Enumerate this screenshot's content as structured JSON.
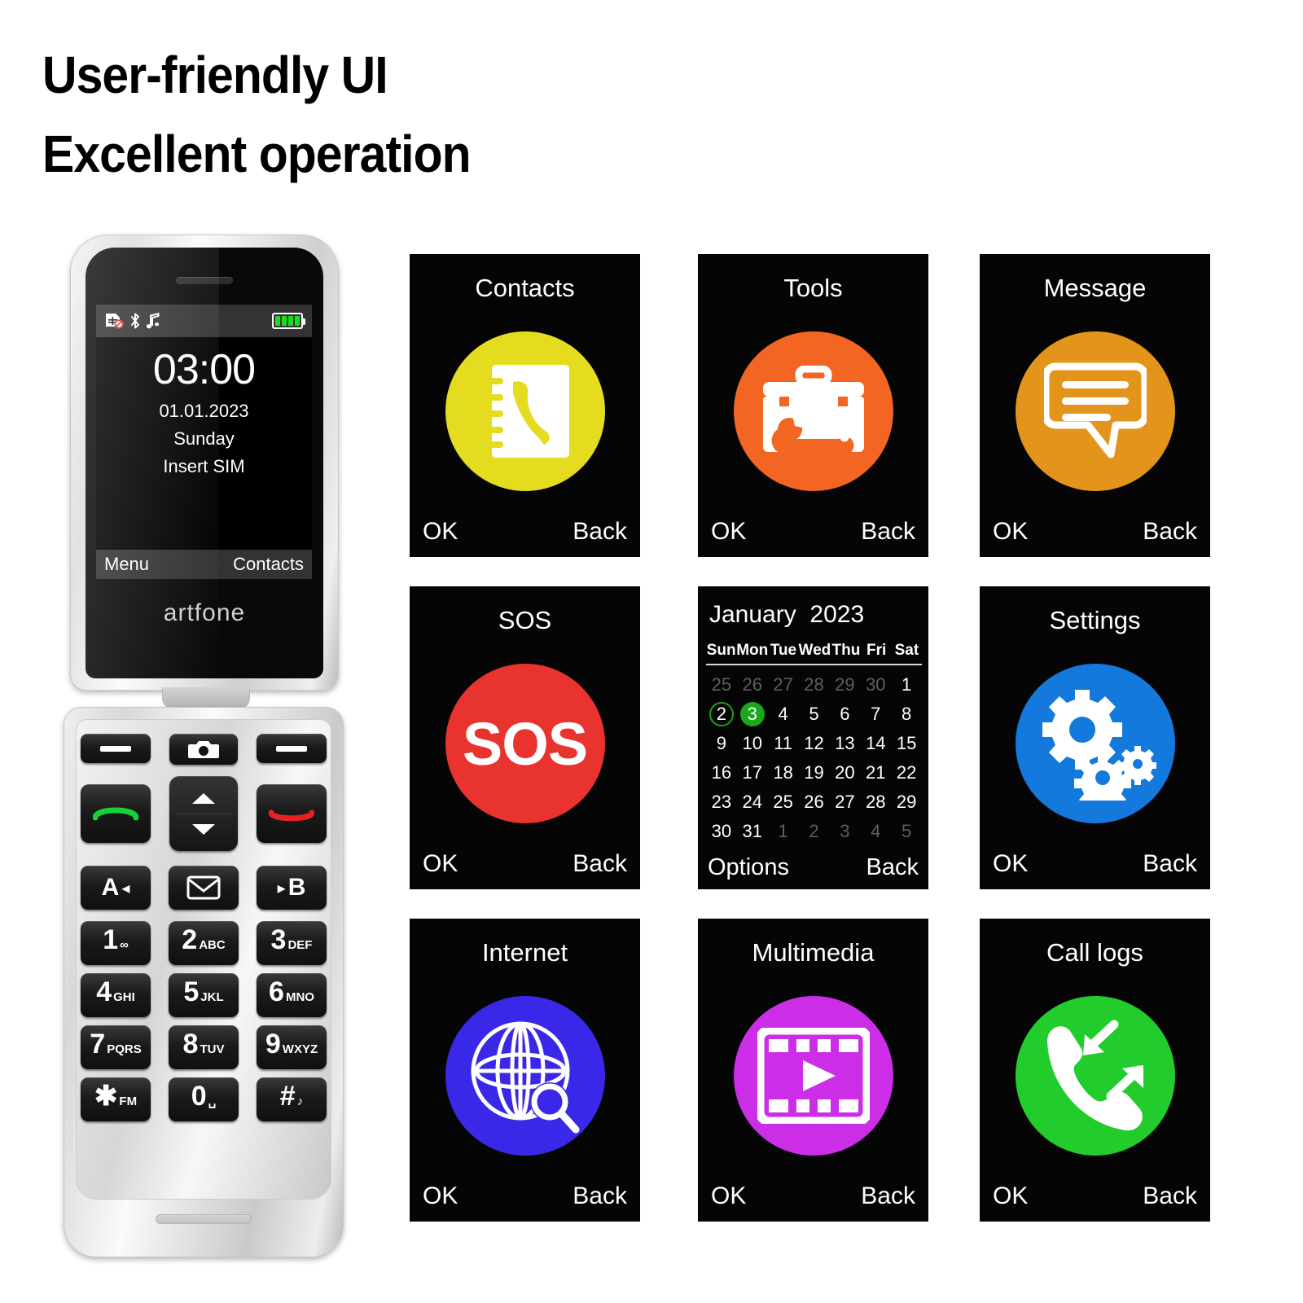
{
  "headline": {
    "line1": "User-friendly UI",
    "line2": "Excellent operation"
  },
  "phone": {
    "brand": "artfone",
    "screen": {
      "status_icons": [
        "sim-blocked-icon",
        "bluetooth-icon",
        "music-note-icon",
        "battery-full-icon"
      ],
      "time": "03:00",
      "date": "01.01.2023",
      "weekday": "Sunday",
      "sim_status": "Insert SIM",
      "softkey_left": "Menu",
      "softkey_right": "Contacts"
    },
    "keys": {
      "row_soft": [
        "soft-left-key",
        "camera-key",
        "soft-right-key"
      ],
      "row_call": [
        "call-answer-key",
        "nav-updown-key",
        "call-end-key"
      ],
      "row_fn": [
        {
          "label": "A",
          "arrow": "◂"
        },
        {
          "label": "envelope-icon",
          "arrow": ""
        },
        {
          "label": "B",
          "arrow": "▸"
        }
      ],
      "numbers": [
        {
          "main": "1",
          "sub": "∞"
        },
        {
          "main": "2",
          "sub": "ABC"
        },
        {
          "main": "3",
          "sub": "DEF"
        },
        {
          "main": "4",
          "sub": "GHI"
        },
        {
          "main": "5",
          "sub": "JKL"
        },
        {
          "main": "6",
          "sub": "MNO"
        },
        {
          "main": "7",
          "sub": "PQRS"
        },
        {
          "main": "8",
          "sub": "TUV"
        },
        {
          "main": "9",
          "sub": "WXYZ"
        },
        {
          "main": "✱",
          "sub": "FM"
        },
        {
          "main": "0",
          "sub": "␣"
        },
        {
          "main": "#",
          "sub": "♪"
        }
      ]
    }
  },
  "tiles": {
    "softkey_ok": "OK",
    "softkey_back": "Back",
    "items": [
      {
        "title": "Contacts",
        "icon": "address-book-icon",
        "color": "#E5DC1F"
      },
      {
        "title": "Tools",
        "icon": "toolbox-icon",
        "color": "#F26522"
      },
      {
        "title": "Message",
        "icon": "chat-bubble-icon",
        "color": "#E2951A"
      },
      {
        "title": "SOS",
        "icon": "sos-icon",
        "color": "#E8332F",
        "icon_text": "SOS"
      },
      {
        "title": "Settings",
        "icon": "gears-icon",
        "color": "#1479DC"
      },
      {
        "title": "Internet",
        "icon": "globe-search-icon",
        "color": "#3A28E8"
      },
      {
        "title": "Multimedia",
        "icon": "film-play-icon",
        "color": "#CC2EE8"
      },
      {
        "title": "Call logs",
        "icon": "phone-arrows-icon",
        "color": "#22CC2C"
      }
    ]
  },
  "calendar": {
    "month": "January",
    "year": "2023",
    "dow": [
      "Sun",
      "Mon",
      "Tue",
      "Wed",
      "Thu",
      "Fri",
      "Sat"
    ],
    "weeks": [
      [
        {
          "d": "25",
          "o": 1
        },
        {
          "d": "26",
          "o": 1
        },
        {
          "d": "27",
          "o": 1
        },
        {
          "d": "28",
          "o": 1
        },
        {
          "d": "29",
          "o": 1
        },
        {
          "d": "30",
          "o": 1
        },
        {
          "d": "1",
          "o": 0
        }
      ],
      [
        {
          "d": "2",
          "o": 0,
          "ring": 1
        },
        {
          "d": "3",
          "o": 0,
          "fill": 1
        },
        {
          "d": "4",
          "o": 0
        },
        {
          "d": "5",
          "o": 0
        },
        {
          "d": "6",
          "o": 0
        },
        {
          "d": "7",
          "o": 0
        },
        {
          "d": "8",
          "o": 0
        }
      ],
      [
        {
          "d": "9",
          "o": 0
        },
        {
          "d": "10",
          "o": 0
        },
        {
          "d": "11",
          "o": 0
        },
        {
          "d": "12",
          "o": 0
        },
        {
          "d": "13",
          "o": 0
        },
        {
          "d": "14",
          "o": 0
        },
        {
          "d": "15",
          "o": 0
        }
      ],
      [
        {
          "d": "16",
          "o": 0
        },
        {
          "d": "17",
          "o": 0
        },
        {
          "d": "18",
          "o": 0
        },
        {
          "d": "19",
          "o": 0
        },
        {
          "d": "20",
          "o": 0
        },
        {
          "d": "21",
          "o": 0
        },
        {
          "d": "22",
          "o": 0
        }
      ],
      [
        {
          "d": "23",
          "o": 0
        },
        {
          "d": "24",
          "o": 0
        },
        {
          "d": "25",
          "o": 0
        },
        {
          "d": "26",
          "o": 0
        },
        {
          "d": "27",
          "o": 0
        },
        {
          "d": "28",
          "o": 0
        },
        {
          "d": "29",
          "o": 0
        }
      ],
      [
        {
          "d": "30",
          "o": 0
        },
        {
          "d": "31",
          "o": 0
        },
        {
          "d": "1",
          "o": 1
        },
        {
          "d": "2",
          "o": 1
        },
        {
          "d": "3",
          "o": 1
        },
        {
          "d": "4",
          "o": 1
        },
        {
          "d": "5",
          "o": 1
        }
      ]
    ],
    "softkey_left": "Options",
    "softkey_right": "Back",
    "highlight_ring_color": "#17A317",
    "highlight_fill_color": "#1AA81A"
  }
}
